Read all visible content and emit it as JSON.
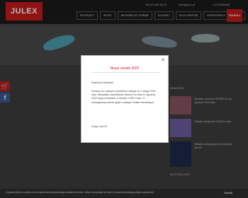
{
  "header": {
    "logo": "JULEX",
    "phone": "+48 42 640 06 10",
    "email": "info@julex.pl",
    "account": "LOGOWANIE",
    "nav": [
      "PRODUKTY",
      "SKLEP",
      "INFORMACJE OFIRMIE",
      "KONTAKT",
      "DLA KLIENTÓW",
      "WSPÓŁPRACA",
      "BLOG"
    ],
    "search": "SZUKAJ"
  },
  "sidebar": {
    "title": "NOWOŚCI",
    "items": [
      {
        "name": "Sandały ochronne SPORT NL na sprzęcie Thermore"
      },
      {
        "name": "Obuwie medyczne JULEX Luma"
      },
      {
        "name": "Wkładki ortopedyczne do obuwia JULEX"
      }
    ],
    "bestsellers": "BESTSELLERY"
  },
  "modal": {
    "title": "Nowy cennik 2022",
    "greeting": "Szanowni Państwo!",
    "body": "Zmiana cen naszych produktów nastąpi od 1 lutego 2022 roku. Wszystkie zamówienia złożone do dnia 31 stycznia 2022 będą rozliczane w cenach z 2021 roku. O szczegółowy cennik pytaj w naszym Dziale Handlowym.",
    "signature": "Grupa JULEX"
  },
  "cookie": {
    "text": "Używamy plików cookies w celu zapewnienia prawidłowego działania serwisu. Dalsze korzystanie ze strony oznacza akceptację polityki prywatności.",
    "link": "Zamknij"
  },
  "colors": {
    "accent": "#c61b1b"
  }
}
